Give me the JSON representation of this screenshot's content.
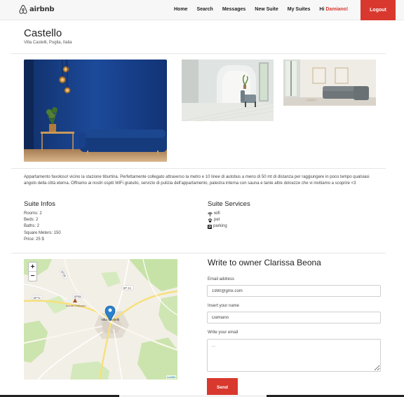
{
  "nav": {
    "logo_text": "airbnb",
    "links": [
      "Home",
      "Search",
      "Messages",
      "New Suite",
      "My Suites"
    ],
    "greeting": "Hi",
    "user_name": "Damiano!",
    "logout": "Logout",
    "accent_color": "#d9382e"
  },
  "suite": {
    "title": "Castello",
    "address": "Villa Castelli, Puglia, Italia",
    "description": "Appartamento favoloso! vicino la stazione tiburtina. Perfettamente collegato attraverso la metro e 10 linee di autobus a meno di 50 mt di distanza per raggiungere in poco tempo qualsiasi angolo della città eterna. Offriamo ai nostri ospiti WiFi gratuito, servizio di pulizia dell'appartamento, palestra interna con sauna e tante altre dolcezze che vi invitiamo a scoprire <3"
  },
  "infos": {
    "title": "Suite Infos",
    "rooms": "Rooms: 2",
    "beds": "Beds: 2",
    "baths": "Baths: 2",
    "square_meters": "Square Meters: 150",
    "price": "Price: 25 $"
  },
  "services": {
    "title": "Suite Services",
    "items": [
      {
        "label": "wifi",
        "icon": "wifi-icon"
      },
      {
        "label": "pet",
        "icon": "paw-icon"
      },
      {
        "label": "parking",
        "icon": "parking-icon"
      }
    ]
  },
  "map": {
    "zoom_in": "+",
    "zoom_out": "−",
    "attribution": "Leaflet",
    "town_label": "Villa Castelli",
    "road_labels": [
      "SP72",
      "SP68",
      "SP 24",
      "SP28"
    ],
    "poi_label": "Monte Pellicano",
    "marker_icon": "map-marker-icon"
  },
  "contact": {
    "title": "Write to owner Clarissa Beona",
    "email_label": "Email address",
    "email_value": "1990@gmx.com",
    "name_label": "Insert your name",
    "name_value": "Damiano",
    "message_label": "Write your email",
    "message_placeholder": "...",
    "send_label": "Send"
  }
}
